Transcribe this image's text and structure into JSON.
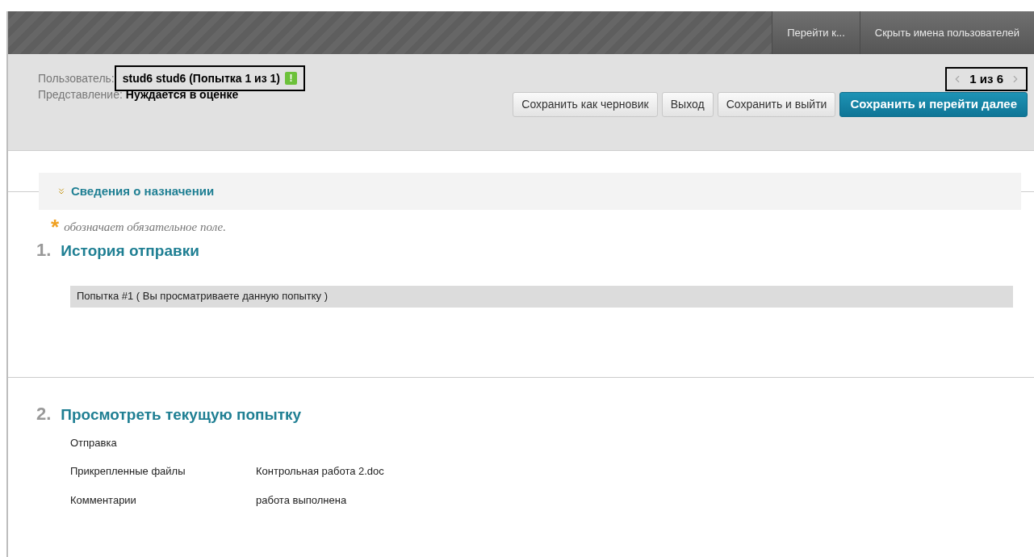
{
  "toolbar": {
    "links": [
      {
        "label": "Перейти к..."
      },
      {
        "label": "Скрыть имена пользователей"
      }
    ]
  },
  "header": {
    "user_label": "Пользователь:",
    "user_value": "stud6 stud6 (Попытка 1 из 1)",
    "status_icon": "!",
    "submission_label": "Представление:",
    "submission_value": "Нуждается в оценке",
    "pager": {
      "text": "1 из 6"
    },
    "buttons": [
      {
        "label": "Сохранить как черновик",
        "kind": "default"
      },
      {
        "label": "Выход",
        "kind": "default"
      },
      {
        "label": "Сохранить и выйти",
        "kind": "default"
      },
      {
        "label": "Сохранить и перейти далее",
        "kind": "primary"
      }
    ]
  },
  "details_section": {
    "title": "Сведения о назначении"
  },
  "required_note": {
    "mark": "*",
    "text": "обозначает обязательное поле."
  },
  "sections": [
    {
      "number": "1.",
      "title": "История отправки",
      "attempts": [
        {
          "label": "Попытка #1 ( Вы просматриваете данную попытку )"
        }
      ]
    },
    {
      "number": "2.",
      "title": "Просмотреть текущую попытку",
      "fields": [
        {
          "label": "Отправка"
        },
        {
          "label": "Прикрепленные файлы",
          "value": "Контрольная работа 2.doc"
        },
        {
          "label": "Комментарии",
          "value": "работа выполнена"
        }
      ]
    }
  ]
}
